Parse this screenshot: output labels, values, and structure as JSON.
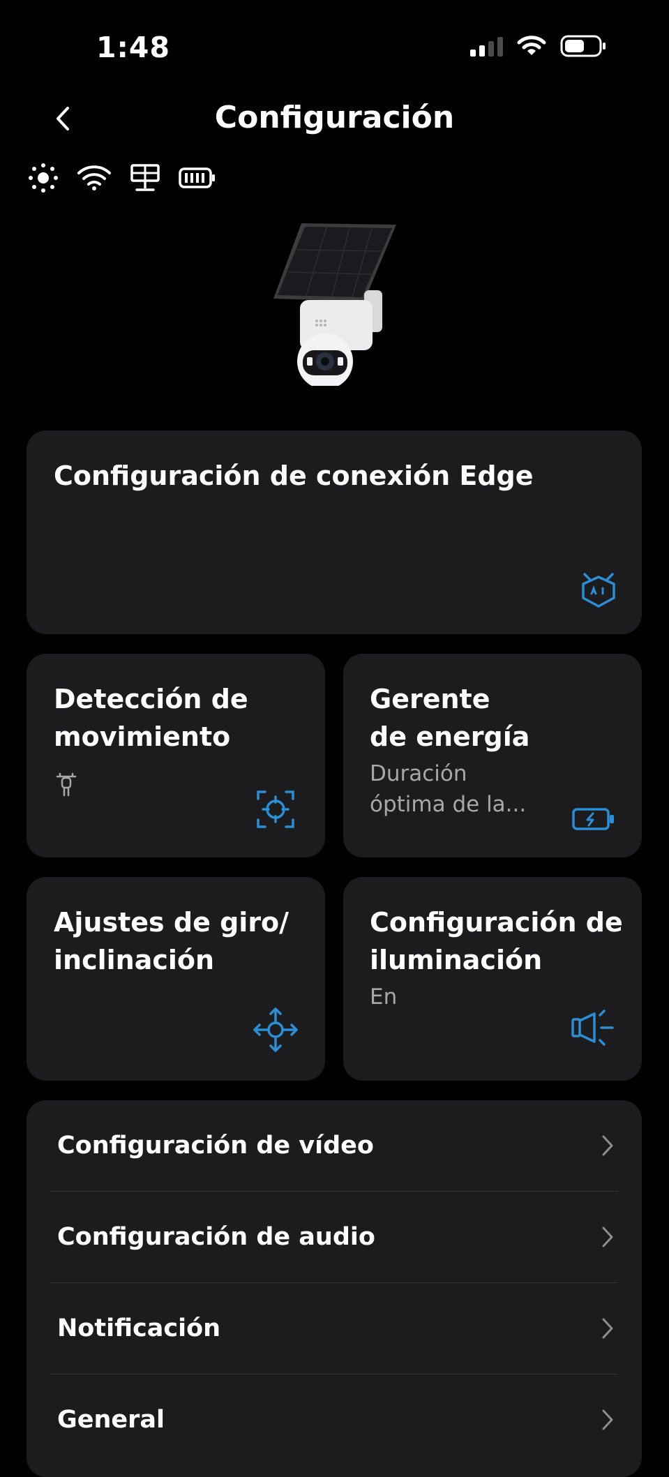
{
  "status_bar": {
    "time": "1:48"
  },
  "header": {
    "title": "Configuración",
    "back_icon": "chevron-left-icon"
  },
  "device_status": [
    "sun-icon",
    "wifi-icon",
    "solar-panel-icon",
    "battery-icon"
  ],
  "cards": {
    "edge": {
      "title": "Configuración de conexión Edge",
      "icon": "ai-robot-icon"
    },
    "motion": {
      "title_line1": "Detección de",
      "title_line2": "movimiento",
      "icon": "motion-target-icon",
      "sub_icon": "person-icon"
    },
    "energy": {
      "title_line1": "Gerente",
      "title_line2": "de energía",
      "sub_line1": "Duración",
      "sub_line2": "óptima de la...",
      "icon": "battery-charging-icon"
    },
    "pan": {
      "title_line1": "Ajustes de giro/",
      "title_line2": "inclinación",
      "icon": "pan-tilt-arrows-icon"
    },
    "light": {
      "title_line1": "Configuración de",
      "title_line2": "iluminación",
      "sub": "En",
      "icon": "spotlight-icon"
    }
  },
  "menu": [
    {
      "label": "Configuración de vídeo"
    },
    {
      "label": "Configuración de audio"
    },
    {
      "label": "Notificación"
    },
    {
      "label": "General"
    }
  ],
  "colors": {
    "accent": "#2a8fd6",
    "card_bg": "#1c1c1e",
    "background": "#000000"
  }
}
